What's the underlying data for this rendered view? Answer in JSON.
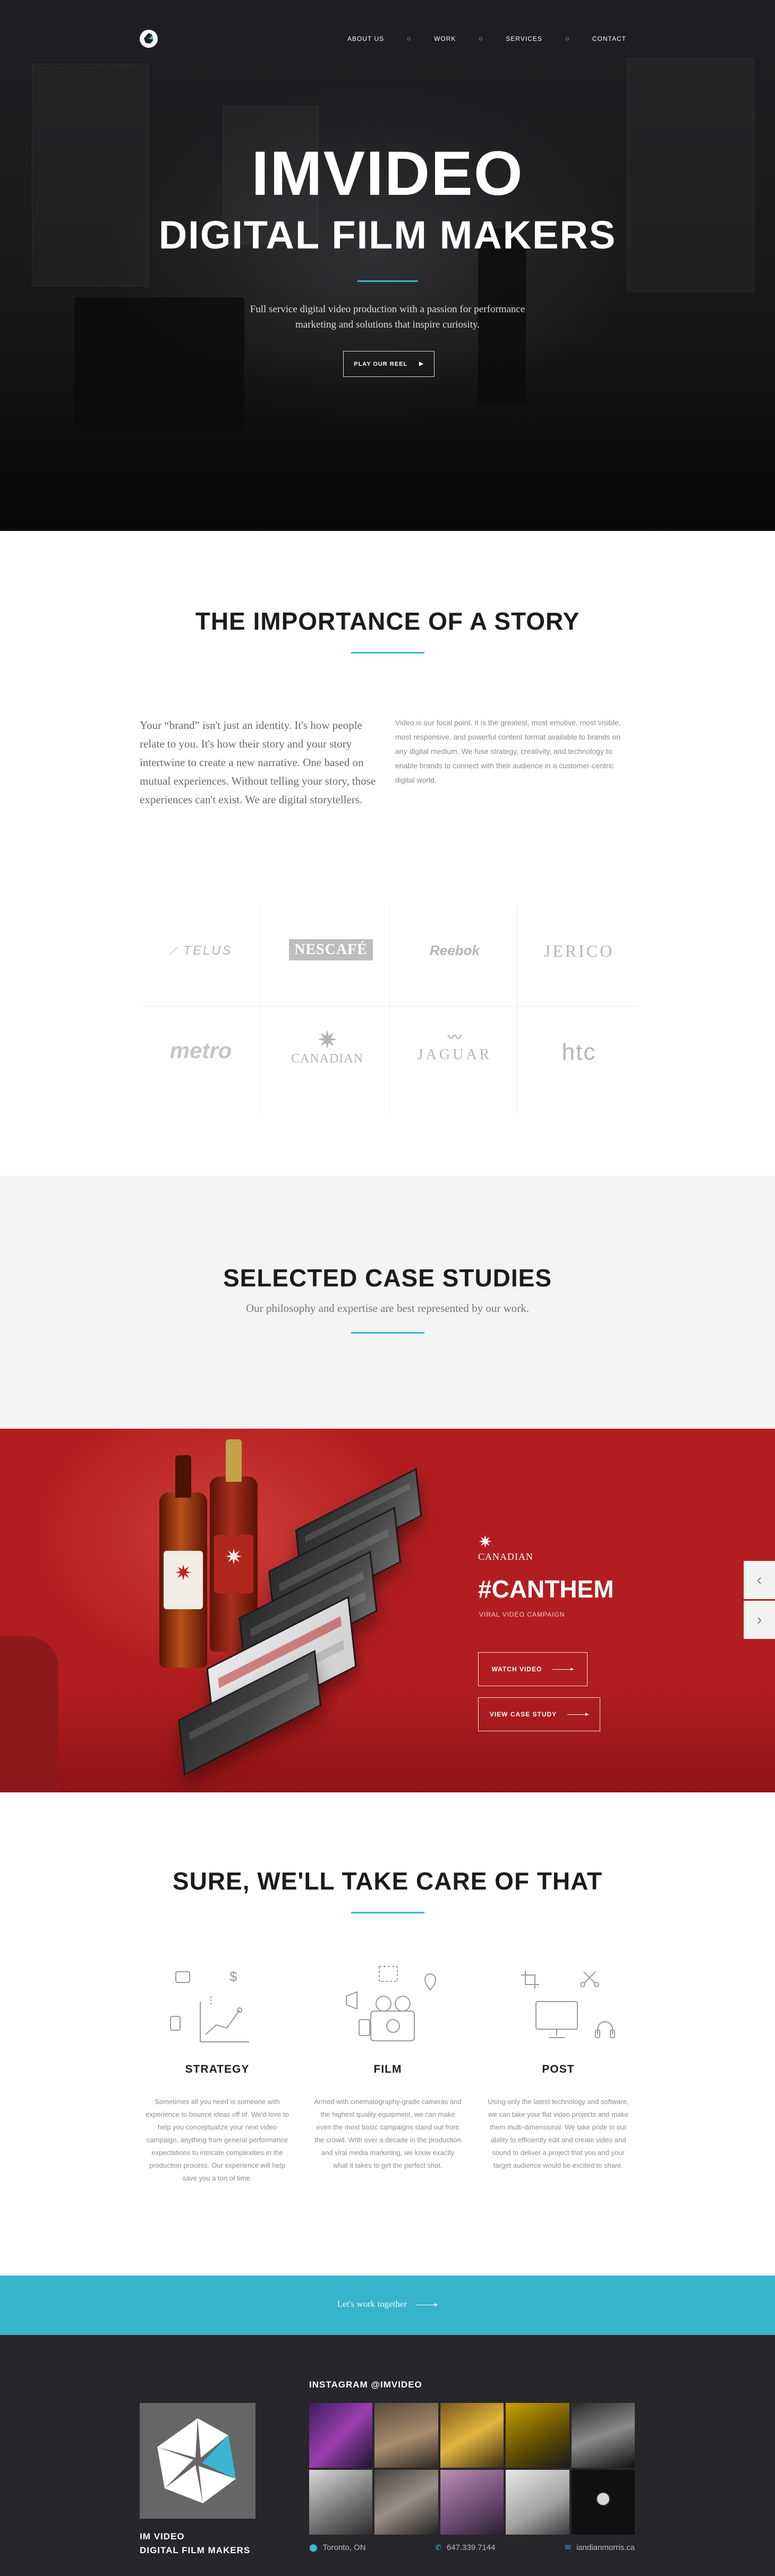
{
  "nav": {
    "items": [
      "ABOUT US",
      "WORK",
      "SERVICES",
      "CONTACT"
    ]
  },
  "hero": {
    "title_line1": "IMVIDEO",
    "title_line2": "DIGITAL FILM MAKERS",
    "subtitle_line1": "Full service digital video production with a passion for performance",
    "subtitle_line2": "marketing and solutions that inspire curiosity.",
    "reel_button": "PLAY OUR REEL"
  },
  "story": {
    "heading": "THE IMPORTANCE OF A STORY",
    "left_text": "Your “brand” isn't just an identity. It's how people relate to you. It's how their story and your story intertwine to create a new narrative. One based on mutual experiences. Without telling your story, those experiences can't exist. We are digital storytellers.",
    "right_text": "Video is our focal point. It is the greatest, most emotive, most visible, most responsive, and powerful content format available to brands on any digital medium. We fuse strategy, creativity, and technology to enable brands to connect with their audience in a customer-centric digital world."
  },
  "clients": [
    "TELUS",
    "NESCAFÉ",
    "Reebok",
    "JERICO",
    "metro",
    "CANADIAN",
    "JAGUAR",
    "htc"
  ],
  "case_studies": {
    "heading": "SELECTED CASE STUDIES",
    "subtitle": "Our philosophy and expertise are best represented by our work.",
    "featured": {
      "brand": "CANADIAN",
      "title": "#CANTHEM",
      "tag": "VIRAL VIDEO CAMPAIGN",
      "watch_button": "WATCH VIDEO",
      "case_button": "VIEW CASE STUDY"
    }
  },
  "services": {
    "heading": "SURE, WE'LL TAKE CARE OF THAT",
    "items": [
      {
        "title": "STRATEGY",
        "text": "Sometimes all you need is someone with experience to bounce ideas off of. We'd love to help you conceptualize your next video campaign, anything from general performance expectations to intricate complexities in the production process. Our experience will help save you a ton of time."
      },
      {
        "title": "FILM",
        "text": "Armed with cinematography-grade cameras and the highest quality equipment, we can make even the most basic campaigns stand out from the crowd. With over a decade in the production and viral media marketing, we know exactly what it takes to get the perfect shot."
      },
      {
        "title": "POST",
        "text": "Using only the latest technology and software, we can take your flat video projects and make them multi-dimensional. We take pride in our ability to efficiently edit and create video and sound to deliver a project that you and your target audience would be excited to share."
      }
    ]
  },
  "cta": {
    "text": "Let's work together"
  },
  "footer": {
    "name_line1": "IM VIDEO",
    "name_line2": "DIGITAL FILM MAKERS",
    "instagram_heading": "INSTAGRAM @IMVIDEO",
    "location": "Toronto, ON",
    "phone": "647.339.7144",
    "email": "iandianmorris.ca"
  },
  "colors": {
    "accent": "#3bb6d0",
    "case_red": "#b21e1f",
    "footer_bg": "#26262b"
  }
}
